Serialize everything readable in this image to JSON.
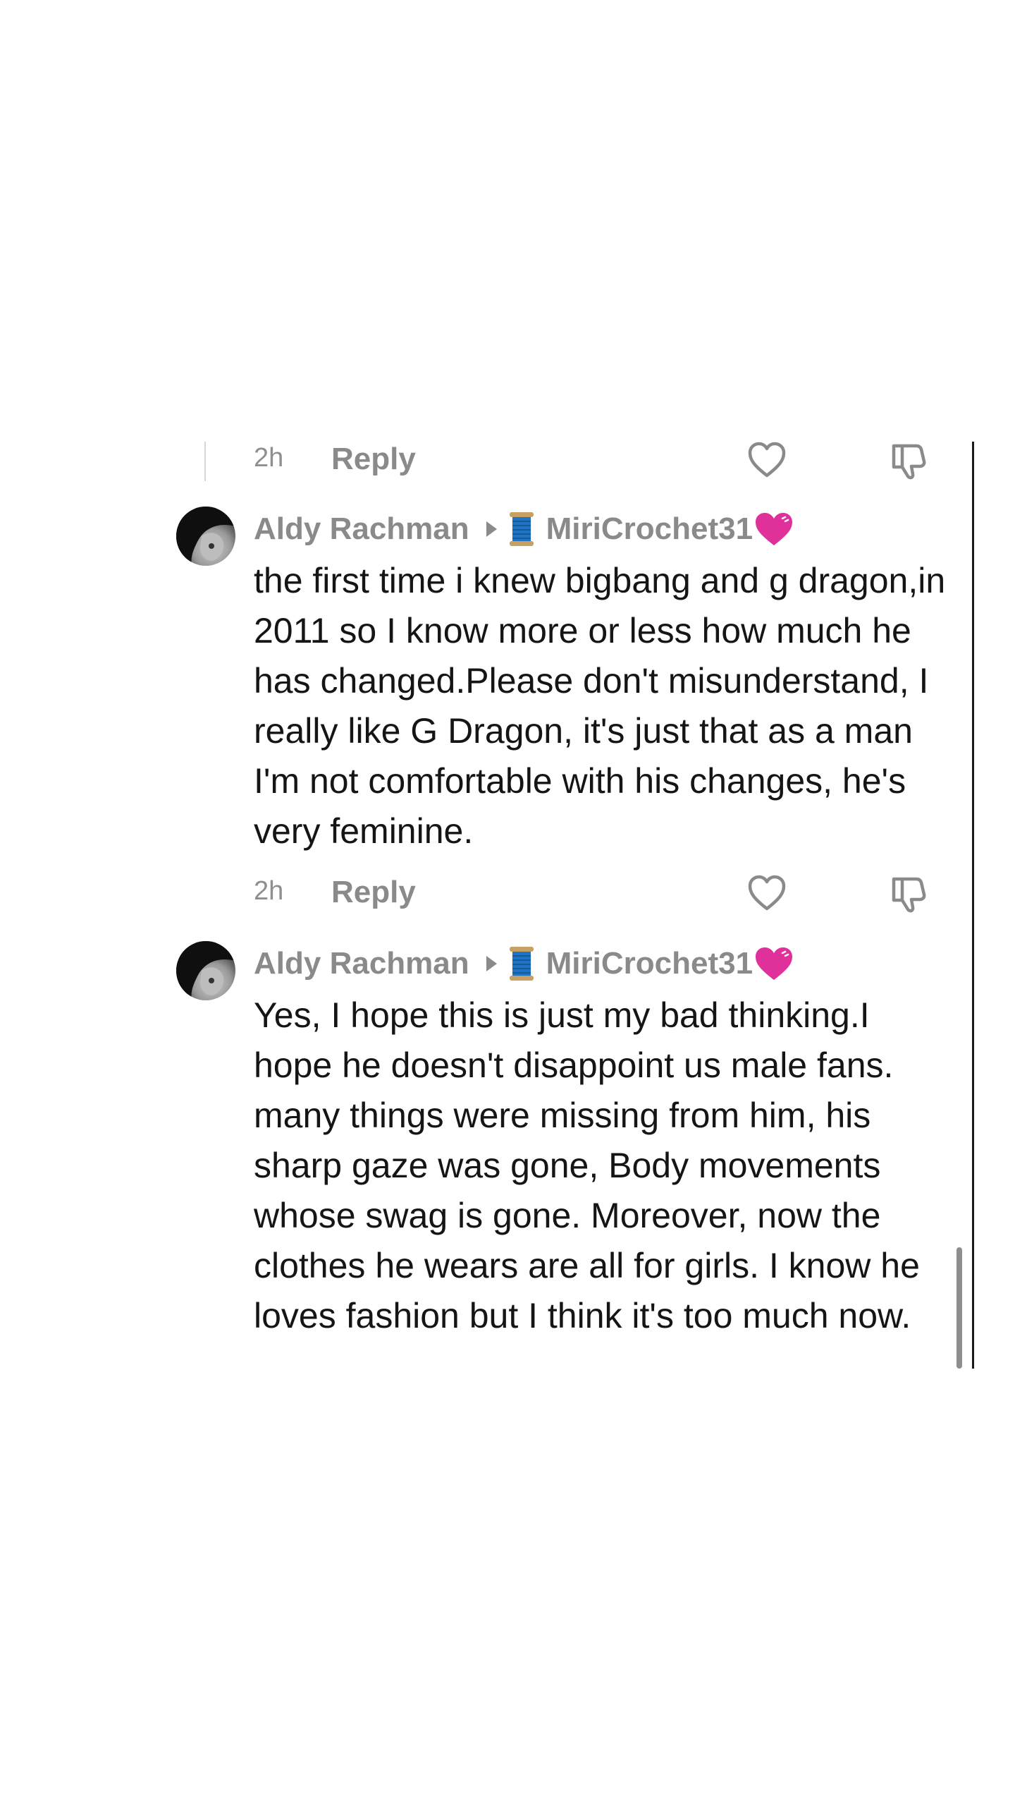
{
  "thread": {
    "top_meta": {
      "time": "2h",
      "reply_label": "Reply"
    },
    "comments": [
      {
        "author": "Aldy Rachman",
        "recipient": "MiriCrochet31",
        "text": "the first time i knew bigbang and g dragon,in 2011 so I know more or less how much he has changed.Please don't misunderstand, I really like G Dragon, it's just that as a man I'm not comfortable with his changes, he's very feminine.",
        "time": "2h",
        "reply_label": "Reply"
      },
      {
        "author": "Aldy Rachman",
        "recipient": "MiriCrochet31",
        "text": "Yes, I hope this is just my bad thinking.I hope he doesn't disappoint us male fans. many things were missing from him, his sharp gaze was gone, Body movements whose swag is gone. Moreover, now the clothes he wears are all for girls. I know he loves fashion but I think it's too much now."
      }
    ]
  },
  "icons": {
    "like": "heart-outline-icon",
    "dislike": "thumbs-down-outline-icon",
    "reply_arrow": "play-triangle-icon",
    "spool": "thread-spool-emoji",
    "heart": "pink-heart-emoji"
  },
  "colors": {
    "meta_gray": "#8a8a8a",
    "heart_pink": "#e0309a",
    "spool_blue": "#1f74c4"
  }
}
